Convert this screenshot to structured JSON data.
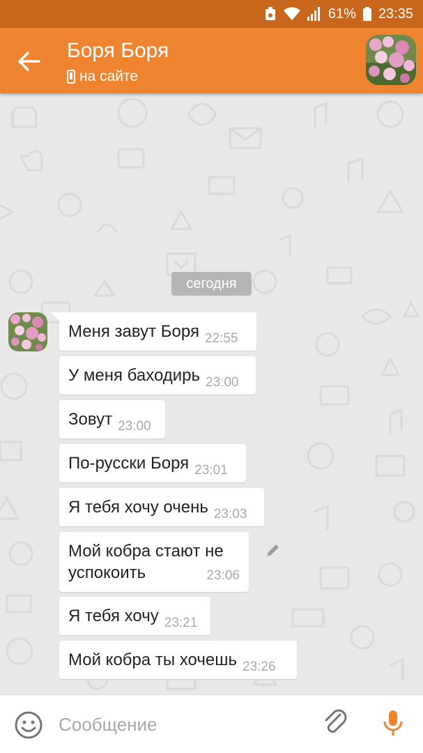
{
  "status_bar": {
    "battery": "61%",
    "time": "23:35",
    "icons": [
      "recycle-icon",
      "wifi-icon",
      "signal-icon",
      "battery-icon"
    ]
  },
  "header": {
    "title": "Боря Боря",
    "status": "на сайте",
    "status_icon": "mobile-phone-icon",
    "back_icon": "arrow-left-icon",
    "accent": "#ee8330"
  },
  "chat": {
    "date_label": "сегодня",
    "messages": [
      {
        "text": "Меня завут Боря",
        "time": "22:55"
      },
      {
        "text": "У меня баходирь",
        "time": "23:00"
      },
      {
        "text": "Зовут",
        "time": "23:00"
      },
      {
        "text": "По-русски Боря",
        "time": "23:01"
      },
      {
        "text": "Я тебя хочу очень",
        "time": "23:03"
      },
      {
        "text": "Мой кобра стают не успокоить",
        "time": "23:06"
      },
      {
        "text": "Я тебя хочу",
        "time": "23:21"
      },
      {
        "text": "Мой кобра ты хочешь",
        "time": "23:26"
      }
    ]
  },
  "input": {
    "placeholder": "Сообщение",
    "value": ""
  },
  "colors": {
    "status_bar": "#c8661c",
    "app_bar": "#ee8330",
    "chat_bg": "#e8e8e8",
    "mic": "#ee8330"
  }
}
